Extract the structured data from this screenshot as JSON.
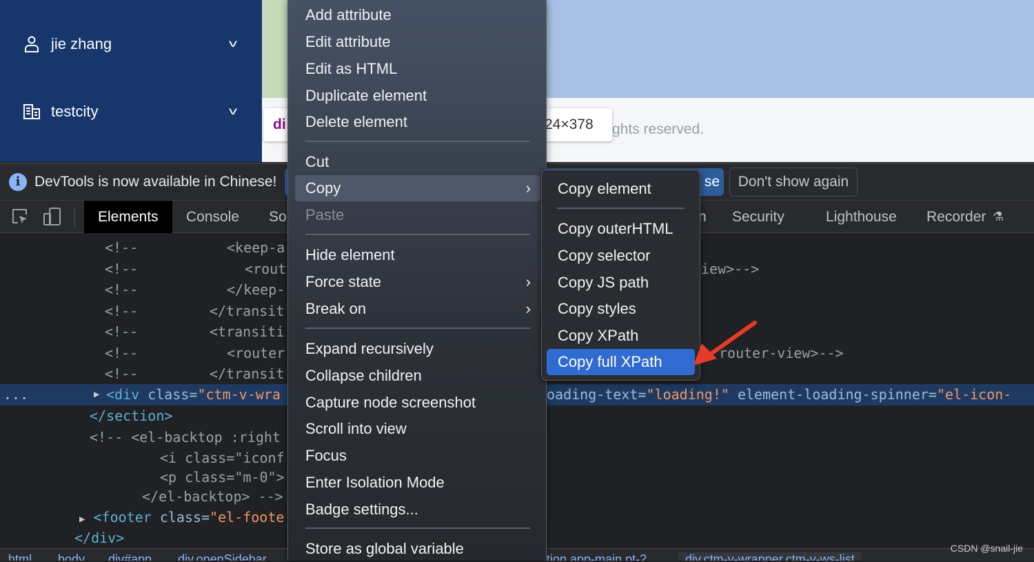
{
  "sidebar": {
    "items": [
      {
        "label": "jie zhang",
        "icon": "user-icon"
      },
      {
        "label": "testcity",
        "icon": "building-icon"
      }
    ]
  },
  "page": {
    "footer_text": "ghts reserved.",
    "tooltip": {
      "tag": "di",
      "dims": "24×378"
    }
  },
  "devtools": {
    "infobar": {
      "message": "DevTools is now available in Chinese!",
      "switch_label": "se",
      "dont_show_label": "Don't show again"
    },
    "tabs": [
      {
        "label": "Elements",
        "active": true
      },
      {
        "label": "Console"
      },
      {
        "label": "So"
      },
      {
        "label": "n"
      },
      {
        "label": "Security"
      },
      {
        "label": "Lighthouse"
      },
      {
        "label": "Recorder"
      }
    ],
    "code_lines": [
      {
        "a": "<!--",
        "b": "<keep-a"
      },
      {
        "a": "<!--",
        "b": "<rout",
        "r": "iew>-->"
      },
      {
        "a": "<!--",
        "b": "</keep-"
      },
      {
        "a": "<!--",
        "b": "</transit"
      },
      {
        "a": "<!--",
        "b": "<transiti"
      },
      {
        "a": "<!--",
        "b": "<router",
        "r": "router-view>-->"
      },
      {
        "a": "<!--",
        "b": "</transit"
      }
    ],
    "selected_line": {
      "ellipsis": "...",
      "tag": "<div ",
      "attr": "class=",
      "val": "\"ctm-v-wra",
      "right_attr": "oading-text=",
      "right_val": "\"loading!\"",
      "right_attr2": " element-loading-spinner=",
      "right_val2": "\"el-icon-"
    },
    "more_lines": {
      "section_close": "</section>",
      "backtop_open": "<!-- <el-backtop :right",
      "i_line": "<i class=\"iconf",
      "p_line": "<p class=\"m-0\">",
      "backtop_close": "</el-backtop> -->",
      "footer_tag": "<footer ",
      "footer_attr": "class=",
      "footer_val": "\"el-foote",
      "div_close": "</div>"
    },
    "breadcrumbs": [
      "html",
      "body",
      "div#app",
      "div.openSidebar",
      "tion.app-main.pt-2",
      "div.ctm-v-wrapper.ctm-v-ws-list"
    ]
  },
  "context_menu": {
    "items": [
      {
        "label": "Add attribute"
      },
      {
        "label": "Edit attribute"
      },
      {
        "label": "Edit as HTML"
      },
      {
        "label": "Duplicate element"
      },
      {
        "label": "Delete element"
      },
      {
        "label": "Cut"
      },
      {
        "label": "Copy",
        "submenu": true,
        "highlighted": true
      },
      {
        "label": "Paste",
        "disabled": true
      },
      {
        "label": "Hide element"
      },
      {
        "label": "Force state",
        "submenu": true
      },
      {
        "label": "Break on",
        "submenu": true
      },
      {
        "label": "Expand recursively"
      },
      {
        "label": "Collapse children"
      },
      {
        "label": "Capture node screenshot"
      },
      {
        "label": "Scroll into view"
      },
      {
        "label": "Focus"
      },
      {
        "label": "Enter Isolation Mode"
      },
      {
        "label": "Badge settings..."
      },
      {
        "label": "Store as global variable"
      }
    ]
  },
  "copy_submenu": {
    "items": [
      {
        "label": "Copy element"
      },
      {
        "label": "Copy outerHTML"
      },
      {
        "label": "Copy selector"
      },
      {
        "label": "Copy JS path"
      },
      {
        "label": "Copy styles"
      },
      {
        "label": "Copy XPath"
      },
      {
        "label": "Copy full XPath",
        "selected": true
      }
    ]
  },
  "watermark": "CSDN @snail-jie",
  "colors": {
    "sidebar": "#17366b",
    "selection": "#2f6bd0",
    "annotation_arrow": "#e8392a"
  }
}
